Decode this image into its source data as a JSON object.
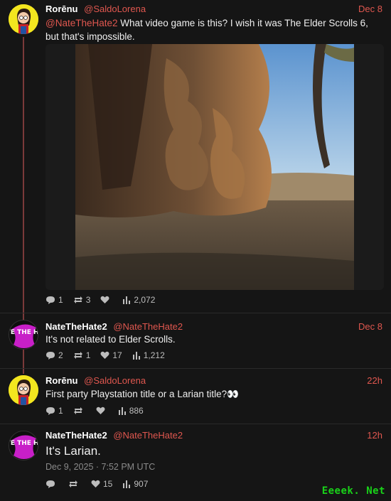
{
  "posts": [
    {
      "name": "Rorēnu",
      "handle": "@SaldoLorena",
      "time": "Dec 8",
      "mention": "@NateTheHate2",
      "text": " What video game is this? I wish it was The Elder Scrolls 6, but that's impossible.",
      "replies": "1",
      "reposts": "3",
      "likes": "",
      "views": "2,072"
    },
    {
      "name": "NateTheHate2",
      "handle": "@NateTheHate2",
      "time": "Dec 8",
      "text": "It's not related to Elder Scrolls.",
      "replies": "2",
      "reposts": "1",
      "likes": "17",
      "views": "1,212"
    },
    {
      "name": "Rorēnu",
      "handle": "@SaldoLorena",
      "time": "22h",
      "text": "First party Playstation title or a Larian title?👀",
      "replies": "1",
      "reposts": "",
      "likes": "",
      "views": "886"
    },
    {
      "name": "NateTheHate2",
      "handle": "@NateTheHate2",
      "time": "12h",
      "text": "It's Larian.",
      "date": "Dec 9, 2025 · 7:52 PM UTC",
      "replies": "",
      "reposts": "",
      "likes": "15",
      "views": "907"
    }
  ],
  "avatar_text": {
    "nate": "NATE THE HATE"
  },
  "watermark": "Eeeek. Net",
  "colors": {
    "accent": "#e0574f",
    "background": "#151515",
    "thread_line": "#7a3a3a",
    "watermark": "#19d219"
  },
  "icons": {
    "reply": "comment-icon",
    "repost": "repost-icon",
    "like": "heart-icon",
    "views": "views-icon"
  }
}
